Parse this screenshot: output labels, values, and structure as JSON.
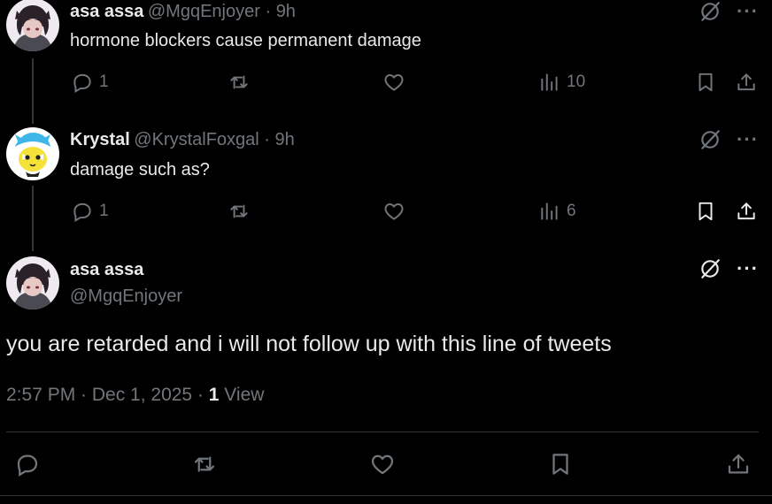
{
  "tweets": [
    {
      "name": "asa assa",
      "handle": "@MgqEnjoyer",
      "sep": " · ",
      "time": "9h",
      "text": "hormone blockers cause permanent damage",
      "replies": "1",
      "views": "10"
    },
    {
      "name": "Krystal",
      "handle": "@KrystalFoxgal",
      "sep": " · ",
      "time": "9h",
      "text": "damage such as?",
      "replies": "1",
      "views": "6"
    }
  ],
  "main": {
    "name": "asa assa",
    "handle": "@MgqEnjoyer",
    "text": "you are retarded and i will not follow up with this line of tweets",
    "timestamp": "2:57 PM · Dec 1, 2025 · ",
    "view_count": "1",
    "view_label": " View"
  },
  "icons": {
    "more": "···",
    "reply": "reply-icon",
    "retweet": "retweet-icon",
    "like": "heart-icon",
    "views": "views-icon",
    "bookmark": "bookmark-icon",
    "share": "share-icon",
    "grok": "grok-icon"
  },
  "colors": {
    "background": "#000000",
    "text": "#e7e9ea",
    "muted": "#71767b",
    "divider": "#2f3336"
  }
}
